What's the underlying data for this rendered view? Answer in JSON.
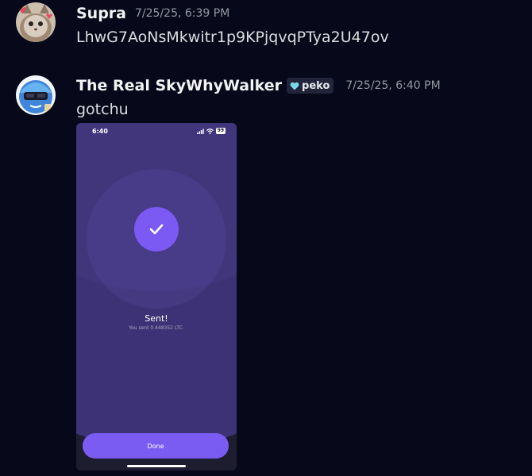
{
  "messages": [
    {
      "username": "Supra",
      "timestamp": "7/25/25, 6:39 PM",
      "text": "LhwG7AoNsMkwitr1p9KPjqvqPTya2U47ov",
      "avatar_icon": "cat-avatar"
    },
    {
      "username": "The Real SkyWhyWalker",
      "tag": {
        "icon": "heart-icon",
        "label": "peko"
      },
      "timestamp": "7/25/25, 6:40 PM",
      "text": "gotchu",
      "avatar_icon": "blue-character-avatar",
      "attachment": {
        "status_time": "6:40",
        "battery": "99",
        "title": "Sent!",
        "subtitle": "You sent 0.448352 LTC.",
        "button_label": "Done"
      }
    }
  ],
  "colors": {
    "background": "#070819",
    "accent": "#7a5af3",
    "username": "#f2f3f5",
    "timestamp": "#949ba4"
  }
}
